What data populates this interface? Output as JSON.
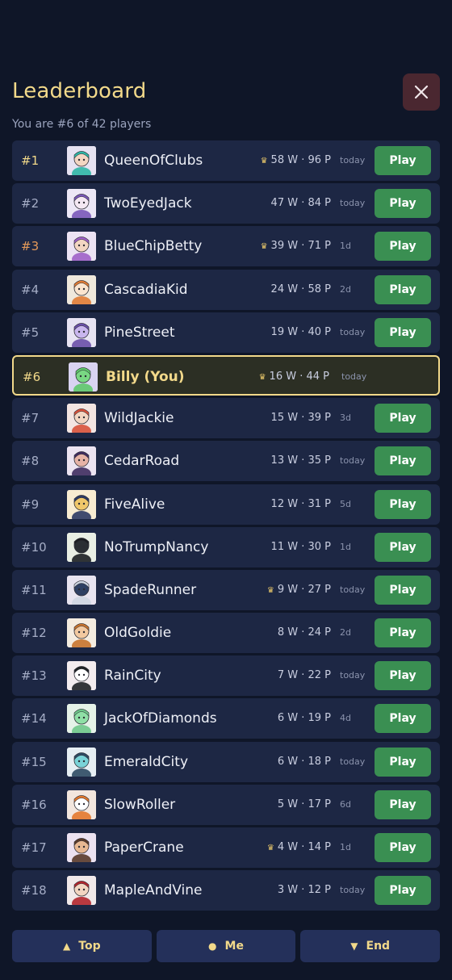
{
  "header": {
    "title": "Leaderboard",
    "close_icon": "close-icon"
  },
  "subtitle": "You are #6 of 42 players",
  "play_label": "Play",
  "colors": {
    "accent": "#f2d98a",
    "play": "#3a8f52",
    "row": "#1d2744",
    "bg": "#0f1628",
    "close_bg": "#4a2730"
  },
  "rows": [
    {
      "rank": "#1",
      "name": "QueenOfClubs",
      "crown": true,
      "stats": "58 W · 96 P",
      "when": "today",
      "play": true,
      "avatar": "teal-hair-avatar"
    },
    {
      "rank": "#2",
      "name": "TwoEyedJack",
      "crown": false,
      "stats": "47 W · 84 P",
      "when": "today",
      "play": true,
      "avatar": "purple-hood-avatar"
    },
    {
      "rank": "#3",
      "name": "BlueChipBetty",
      "crown": true,
      "stats": "39 W · 71 P",
      "when": "1d",
      "play": true,
      "avatar": "purple-hair-avatar"
    },
    {
      "rank": "#4",
      "name": "CascadiaKid",
      "crown": false,
      "stats": "24 W · 58 P",
      "when": "2d",
      "play": true,
      "avatar": "fox-avatar"
    },
    {
      "rank": "#5",
      "name": "PineStreet",
      "crown": false,
      "stats": "19 W · 40 P",
      "when": "today",
      "play": true,
      "avatar": "owl-avatar"
    },
    {
      "rank": "#6",
      "name": "Billy  (You)",
      "crown": true,
      "stats": "16 W · 44 P",
      "when": "today",
      "play": false,
      "avatar": "alien-avatar",
      "me": true
    },
    {
      "rank": "#7",
      "name": "WildJackie",
      "crown": false,
      "stats": "15 W · 39 P",
      "when": "3d",
      "play": true,
      "avatar": "red-hair-avatar"
    },
    {
      "rank": "#8",
      "name": "CedarRoad",
      "crown": false,
      "stats": "13 W · 35 P",
      "when": "today",
      "play": true,
      "avatar": "dark-hair-avatar"
    },
    {
      "rank": "#9",
      "name": "FiveAlive",
      "crown": false,
      "stats": "12 W · 31 P",
      "when": "5d",
      "play": true,
      "avatar": "hat-avatar"
    },
    {
      "rank": "#10",
      "name": "NoTrumpNancy",
      "crown": false,
      "stats": "11 W · 30 P",
      "when": "1d",
      "play": true,
      "avatar": "black-cat-avatar"
    },
    {
      "rank": "#11",
      "name": "SpadeRunner",
      "crown": true,
      "stats": "9 W · 27 P",
      "when": "today",
      "play": true,
      "avatar": "ninja-avatar"
    },
    {
      "rank": "#12",
      "name": "OldGoldie",
      "crown": false,
      "stats": "8 W · 24 P",
      "when": "2d",
      "play": true,
      "avatar": "monkey-avatar"
    },
    {
      "rank": "#13",
      "name": "RainCity",
      "crown": false,
      "stats": "7 W · 22 P",
      "when": "today",
      "play": true,
      "avatar": "panda-avatar"
    },
    {
      "rank": "#14",
      "name": "JackOfDiamonds",
      "crown": false,
      "stats": "6 W · 19 P",
      "when": "4d",
      "play": true,
      "avatar": "dino-avatar"
    },
    {
      "rank": "#15",
      "name": "EmeraldCity",
      "crown": false,
      "stats": "6 W · 18 P",
      "when": "today",
      "play": true,
      "avatar": "robot-avatar"
    },
    {
      "rank": "#16",
      "name": "SlowRoller",
      "crown": false,
      "stats": "5 W · 17 P",
      "when": "6d",
      "play": true,
      "avatar": "fox-kit-avatar"
    },
    {
      "rank": "#17",
      "name": "PaperCrane",
      "crown": true,
      "stats": "4 W · 14 P",
      "when": "1d",
      "play": true,
      "avatar": "person-avatar"
    },
    {
      "rank": "#18",
      "name": "MapleAndVine",
      "crown": false,
      "stats": "3 W · 12 P",
      "when": "today",
      "play": true,
      "avatar": "hero-avatar"
    }
  ],
  "bottom_nav": [
    {
      "label": "Top",
      "glyph": "▲",
      "icon": "triangle-up-icon"
    },
    {
      "label": "Me",
      "glyph": "●",
      "icon": "dot-icon"
    },
    {
      "label": "End",
      "glyph": "▼",
      "icon": "triangle-down-icon"
    }
  ]
}
